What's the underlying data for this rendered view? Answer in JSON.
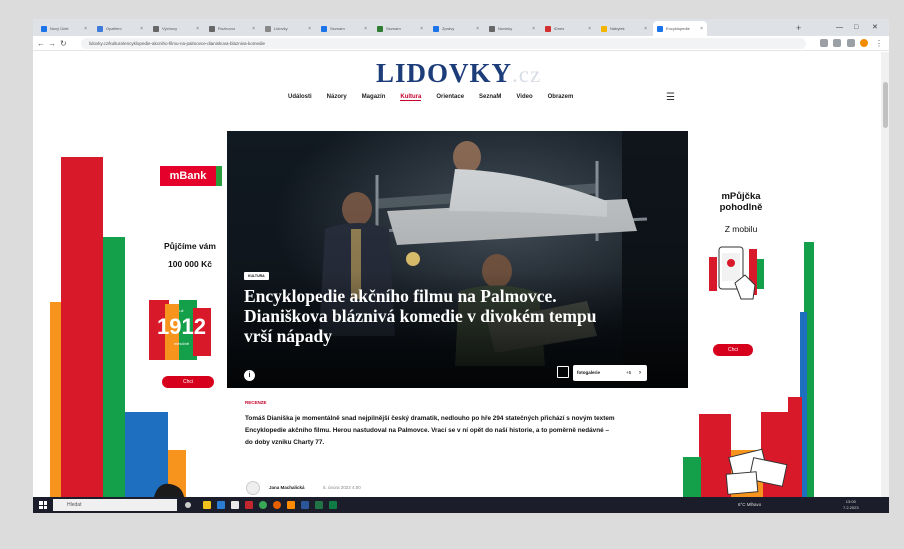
{
  "browser": {
    "tabs": [
      {
        "label": "Nový Účet",
        "icon": "outlook-icon",
        "color": "#1a73e8"
      },
      {
        "label": "Opatření",
        "icon": "page-icon",
        "color": "#3c7bd9"
      },
      {
        "label": "Výchovy",
        "icon": "page-icon",
        "color": "#666666"
      },
      {
        "label": "Rozhovor",
        "icon": "page-icon",
        "color": "#666666"
      },
      {
        "label": "Lidovky",
        "icon": "page-icon",
        "color": "#888888"
      },
      {
        "label": "Seznam",
        "icon": "page-icon",
        "color": "#1a73e8"
      },
      {
        "label": "Seznam",
        "icon": "page-icon",
        "color": "#2e7d32"
      },
      {
        "label": "Zprávy",
        "icon": "page-icon",
        "color": "#1a73e8"
      },
      {
        "label": "Novinky",
        "icon": "page-icon",
        "color": "#666666"
      },
      {
        "label": "iDnes",
        "icon": "page-icon",
        "color": "#d32f2f"
      },
      {
        "label": "Nábytek",
        "icon": "page-icon",
        "color": "#f4b400"
      },
      {
        "label": "Encyklopedie",
        "icon": "page-icon",
        "color": "#1a73e8",
        "active": true
      }
    ],
    "url": "lidovky.cz/kultura/encyklopedie-akcniho-filmu-na-palmovce-dianiskova-blazniva-komedie",
    "new_tab": "+"
  },
  "site": {
    "logo_main": "LIDOVKY",
    "logo_suffix": ".cz",
    "menu": [
      "Události",
      "Názory",
      "Magazín",
      "Kultura",
      "Orientace",
      "SeznaM",
      "Video",
      "Obrazem"
    ],
    "menu_selected": "Kultura"
  },
  "left_ad": {
    "brand": "mBank",
    "text": "Půjčíme vám",
    "amount": "100 000 Kč",
    "badge_number": "1912",
    "badge_top": "už",
    "badge_bottom": "měsíčně",
    "button": "Chci"
  },
  "right_ad": {
    "title": "mPůjčka pohodlně",
    "subtitle": "Z mobilu",
    "button": "Chci"
  },
  "hero": {
    "tag": "KULTURA",
    "headline": "Encyklopedie akčního filmu na Palmovce. Dianiškova bláznivá komedie v divokém tempu vrší nápady",
    "info": "i",
    "gallery_label": "fotogalerie",
    "gallery_count": "+5"
  },
  "article": {
    "section": "RECENZE",
    "perex": "Tomáš Dianiška je momentálně snad nejpilnější český dramatik, nedlouho po hře 294 statečných přichází s novým textem Encyklopedie akčního filmu. Herou nastudoval na Palmovce. Vrací se v ní opět do naší historie, a to poměrně nedávné – do doby vzniku Charty 77.",
    "author": "Jana Machalická",
    "date": "6. února 2023 4:00"
  },
  "taskbar": {
    "search_placeholder": "Hledat",
    "tray": "6°C Mlhavo",
    "time": "13:00",
    "date": "7.2.2023"
  },
  "colors": {
    "lidovky_blue": "#1c3d7a",
    "accent_red": "#c4002b",
    "mbank_red": "#e4002b",
    "mbank_green": "#2a9d3c"
  }
}
